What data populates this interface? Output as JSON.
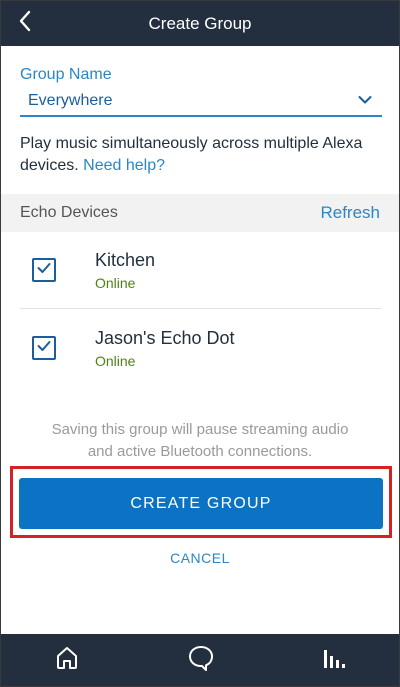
{
  "header": {
    "title": "Create Group",
    "back_icon": "chevron-left-icon"
  },
  "group": {
    "label": "Group Name",
    "value": "Everywhere",
    "dropdown_icon": "chevron-down-icon"
  },
  "description": {
    "text": "Play music simultaneously across multiple Alexa devices.",
    "help_link": "Need help?"
  },
  "devices_section": {
    "title": "Echo Devices",
    "refresh_label": "Refresh",
    "devices": [
      {
        "name": "Kitchen",
        "status": "Online",
        "checked": true
      },
      {
        "name": "Jason's Echo Dot",
        "status": "Online",
        "checked": true
      }
    ]
  },
  "note": {
    "line1": "Saving this group will pause streaming audio",
    "line2": "and active Bluetooth connections."
  },
  "actions": {
    "create_label": "CREATE GROUP",
    "cancel_label": "CANCEL"
  },
  "bottom_nav": {
    "items": [
      "home-icon",
      "chat-icon",
      "equalizer-icon"
    ]
  },
  "colors": {
    "header_bg": "#232f3e",
    "accent": "#2a86c7",
    "primary_button": "#0c72c4",
    "status_online": "#508119",
    "highlight": "#d42027"
  }
}
